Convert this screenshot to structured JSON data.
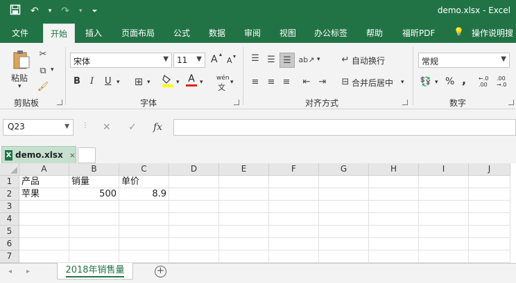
{
  "titlebar": {
    "save_icon": "save-icon",
    "undo_icon": "undo-icon",
    "redo_icon": "redo-icon",
    "customize_icon": "customize-qat-icon",
    "document": "demo.xlsx  -  Excel"
  },
  "tabs": [
    {
      "label": "文件"
    },
    {
      "label": "开始"
    },
    {
      "label": "插入"
    },
    {
      "label": "页面布局"
    },
    {
      "label": "公式"
    },
    {
      "label": "数据"
    },
    {
      "label": "审阅"
    },
    {
      "label": "视图"
    },
    {
      "label": "办公标签"
    },
    {
      "label": "帮助"
    },
    {
      "label": "福昕PDF"
    },
    {
      "label": "操作说明搜"
    }
  ],
  "ribbon": {
    "clipboard": {
      "paste": "粘贴",
      "label": "剪贴板"
    },
    "font": {
      "name": "宋体",
      "size": "11",
      "grow": "A",
      "shrink": "A",
      "bold": "B",
      "italic": "I",
      "underline": "U",
      "font_color_letter": "A",
      "phonetic": "wén",
      "label": "字体"
    },
    "alignment": {
      "wrap_text": "自动换行",
      "merge_center": "合并后居中",
      "label": "对齐方式"
    },
    "number": {
      "format": "常规",
      "percent": "%",
      "comma": ",",
      "inc_decimal": "←.0 .00",
      "dec_decimal": ".00 →.0",
      "label": "数字"
    }
  },
  "formula_bar": {
    "cell_ref": "Q23",
    "cancel": "✕",
    "enter": "✓",
    "fx": "fx",
    "value": ""
  },
  "workbook_tab": {
    "name": "demo.xlsx",
    "close": "×"
  },
  "grid": {
    "columns": [
      "A",
      "B",
      "C",
      "D",
      "E",
      "F",
      "G",
      "H",
      "I",
      "J"
    ],
    "rows": [
      {
        "num": "1",
        "cells": [
          "产品",
          "销量",
          "单价",
          "",
          "",
          "",
          "",
          "",
          "",
          ""
        ]
      },
      {
        "num": "2",
        "cells": [
          "苹果",
          "500",
          "8.9",
          "",
          "",
          "",
          "",
          "",
          "",
          ""
        ]
      },
      {
        "num": "3",
        "cells": [
          "",
          "",
          "",
          "",
          "",
          "",
          "",
          "",
          "",
          ""
        ]
      },
      {
        "num": "4",
        "cells": [
          "",
          "",
          "",
          "",
          "",
          "",
          "",
          "",
          "",
          ""
        ]
      },
      {
        "num": "5",
        "cells": [
          "",
          "",
          "",
          "",
          "",
          "",
          "",
          "",
          "",
          ""
        ]
      },
      {
        "num": "6",
        "cells": [
          "",
          "",
          "",
          "",
          "",
          "",
          "",
          "",
          "",
          ""
        ]
      },
      {
        "num": "7",
        "cells": [
          "",
          "",
          "",
          "",
          "",
          "",
          "",
          "",
          "",
          ""
        ]
      }
    ]
  },
  "sheets": {
    "active": "2018年销售量",
    "add": "+"
  }
}
